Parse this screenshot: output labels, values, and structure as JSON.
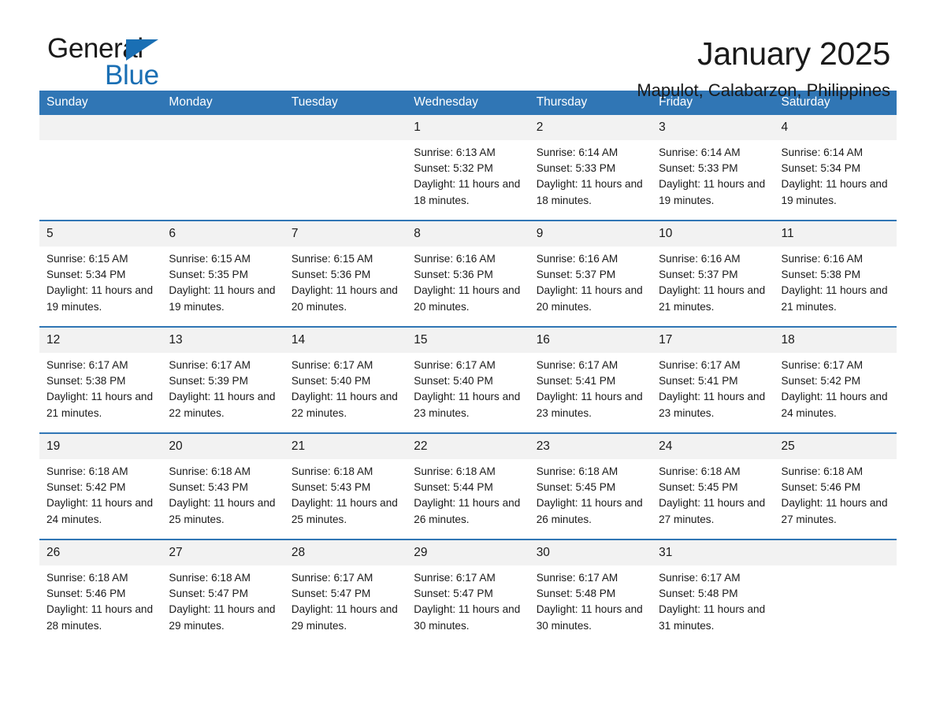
{
  "brand": {
    "name_part1": "General",
    "name_part2": "Blue",
    "accent_color": "#1a6fb4",
    "header_color": "#3076b5"
  },
  "header": {
    "month_title": "January 2025",
    "location": "Mapulot, Calabarzon, Philippines"
  },
  "calendar": {
    "day_headers": [
      "Sunday",
      "Monday",
      "Tuesday",
      "Wednesday",
      "Thursday",
      "Friday",
      "Saturday"
    ],
    "weeks": [
      [
        {
          "day": "",
          "detail": ""
        },
        {
          "day": "",
          "detail": ""
        },
        {
          "day": "",
          "detail": ""
        },
        {
          "day": "1",
          "detail": "Sunrise: 6:13 AM\nSunset: 5:32 PM\nDaylight: 11 hours and 18 minutes."
        },
        {
          "day": "2",
          "detail": "Sunrise: 6:14 AM\nSunset: 5:33 PM\nDaylight: 11 hours and 18 minutes."
        },
        {
          "day": "3",
          "detail": "Sunrise: 6:14 AM\nSunset: 5:33 PM\nDaylight: 11 hours and 19 minutes."
        },
        {
          "day": "4",
          "detail": "Sunrise: 6:14 AM\nSunset: 5:34 PM\nDaylight: 11 hours and 19 minutes."
        }
      ],
      [
        {
          "day": "5",
          "detail": "Sunrise: 6:15 AM\nSunset: 5:34 PM\nDaylight: 11 hours and 19 minutes."
        },
        {
          "day": "6",
          "detail": "Sunrise: 6:15 AM\nSunset: 5:35 PM\nDaylight: 11 hours and 19 minutes."
        },
        {
          "day": "7",
          "detail": "Sunrise: 6:15 AM\nSunset: 5:36 PM\nDaylight: 11 hours and 20 minutes."
        },
        {
          "day": "8",
          "detail": "Sunrise: 6:16 AM\nSunset: 5:36 PM\nDaylight: 11 hours and 20 minutes."
        },
        {
          "day": "9",
          "detail": "Sunrise: 6:16 AM\nSunset: 5:37 PM\nDaylight: 11 hours and 20 minutes."
        },
        {
          "day": "10",
          "detail": "Sunrise: 6:16 AM\nSunset: 5:37 PM\nDaylight: 11 hours and 21 minutes."
        },
        {
          "day": "11",
          "detail": "Sunrise: 6:16 AM\nSunset: 5:38 PM\nDaylight: 11 hours and 21 minutes."
        }
      ],
      [
        {
          "day": "12",
          "detail": "Sunrise: 6:17 AM\nSunset: 5:38 PM\nDaylight: 11 hours and 21 minutes."
        },
        {
          "day": "13",
          "detail": "Sunrise: 6:17 AM\nSunset: 5:39 PM\nDaylight: 11 hours and 22 minutes."
        },
        {
          "day": "14",
          "detail": "Sunrise: 6:17 AM\nSunset: 5:40 PM\nDaylight: 11 hours and 22 minutes."
        },
        {
          "day": "15",
          "detail": "Sunrise: 6:17 AM\nSunset: 5:40 PM\nDaylight: 11 hours and 23 minutes."
        },
        {
          "day": "16",
          "detail": "Sunrise: 6:17 AM\nSunset: 5:41 PM\nDaylight: 11 hours and 23 minutes."
        },
        {
          "day": "17",
          "detail": "Sunrise: 6:17 AM\nSunset: 5:41 PM\nDaylight: 11 hours and 23 minutes."
        },
        {
          "day": "18",
          "detail": "Sunrise: 6:17 AM\nSunset: 5:42 PM\nDaylight: 11 hours and 24 minutes."
        }
      ],
      [
        {
          "day": "19",
          "detail": "Sunrise: 6:18 AM\nSunset: 5:42 PM\nDaylight: 11 hours and 24 minutes."
        },
        {
          "day": "20",
          "detail": "Sunrise: 6:18 AM\nSunset: 5:43 PM\nDaylight: 11 hours and 25 minutes."
        },
        {
          "day": "21",
          "detail": "Sunrise: 6:18 AM\nSunset: 5:43 PM\nDaylight: 11 hours and 25 minutes."
        },
        {
          "day": "22",
          "detail": "Sunrise: 6:18 AM\nSunset: 5:44 PM\nDaylight: 11 hours and 26 minutes."
        },
        {
          "day": "23",
          "detail": "Sunrise: 6:18 AM\nSunset: 5:45 PM\nDaylight: 11 hours and 26 minutes."
        },
        {
          "day": "24",
          "detail": "Sunrise: 6:18 AM\nSunset: 5:45 PM\nDaylight: 11 hours and 27 minutes."
        },
        {
          "day": "25",
          "detail": "Sunrise: 6:18 AM\nSunset: 5:46 PM\nDaylight: 11 hours and 27 minutes."
        }
      ],
      [
        {
          "day": "26",
          "detail": "Sunrise: 6:18 AM\nSunset: 5:46 PM\nDaylight: 11 hours and 28 minutes."
        },
        {
          "day": "27",
          "detail": "Sunrise: 6:18 AM\nSunset: 5:47 PM\nDaylight: 11 hours and 29 minutes."
        },
        {
          "day": "28",
          "detail": "Sunrise: 6:17 AM\nSunset: 5:47 PM\nDaylight: 11 hours and 29 minutes."
        },
        {
          "day": "29",
          "detail": "Sunrise: 6:17 AM\nSunset: 5:47 PM\nDaylight: 11 hours and 30 minutes."
        },
        {
          "day": "30",
          "detail": "Sunrise: 6:17 AM\nSunset: 5:48 PM\nDaylight: 11 hours and 30 minutes."
        },
        {
          "day": "31",
          "detail": "Sunrise: 6:17 AM\nSunset: 5:48 PM\nDaylight: 11 hours and 31 minutes."
        },
        {
          "day": "",
          "detail": ""
        }
      ]
    ]
  }
}
